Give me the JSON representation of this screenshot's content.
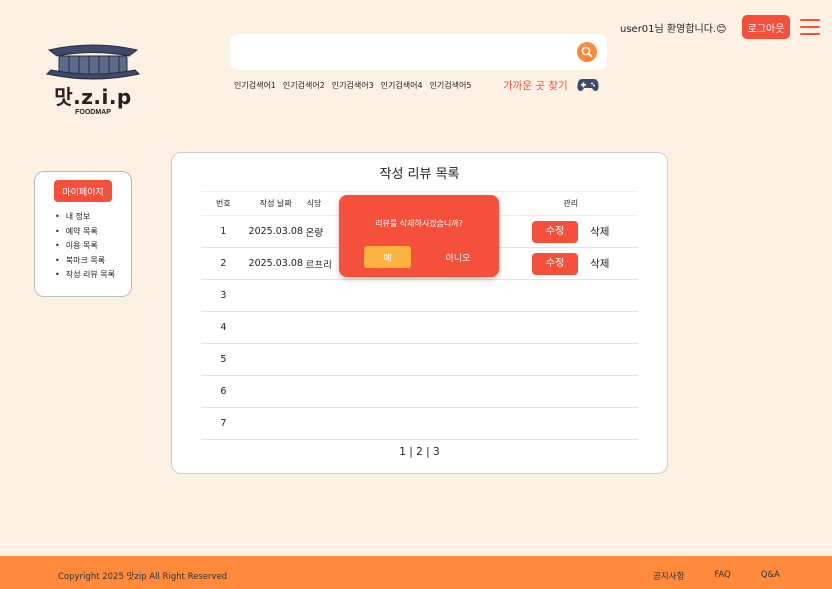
{
  "header": {
    "brand": "맛.z.i.p",
    "brand_sub": "FOODMAP",
    "search": {
      "placeholder": ""
    },
    "popular_searches": [
      "인기검색어1",
      "인기검색어2",
      "인기검색어3",
      "인기검색어4",
      "인기검색어5"
    ],
    "nearby_label": "가까운 곳 찾기",
    "welcome": "user01님 환영합니다.😊",
    "logout_label": "로그아웃",
    "icons": {
      "search": "search-icon",
      "game": "gamepad-icon",
      "menu": "hamburger-menu-icon",
      "logo": "hanok-roof-icon"
    }
  },
  "sidebar": {
    "title": "마이페이지",
    "items": [
      "내 정보",
      "예약 목록",
      "이용 목록",
      "북마크 목록",
      "작성 리뷰 목록"
    ]
  },
  "main": {
    "title": "작성 리뷰 목록",
    "columns": [
      "번호",
      "작성 날짜",
      "식당",
      "",
      "관리"
    ],
    "rows": [
      {
        "num": "1",
        "date": "2025.03.08",
        "restaurant": "온량",
        "edit": "수정",
        "delete": "삭제"
      },
      {
        "num": "2",
        "date": "2025.03.08",
        "restaurant": "르프리",
        "edit": "수정",
        "delete": "삭제"
      },
      {
        "num": "3",
        "date": "",
        "restaurant": "",
        "edit": "",
        "delete": ""
      },
      {
        "num": "4",
        "date": "",
        "restaurant": "",
        "edit": "",
        "delete": ""
      },
      {
        "num": "5",
        "date": "",
        "restaurant": "",
        "edit": "",
        "delete": ""
      },
      {
        "num": "6",
        "date": "",
        "restaurant": "",
        "edit": "",
        "delete": ""
      },
      {
        "num": "7",
        "date": "",
        "restaurant": "",
        "edit": "",
        "delete": ""
      }
    ],
    "pagination": "1 | 2 | 3"
  },
  "modal": {
    "message": "리뷰를 삭제하시겠습니까?",
    "yes_label": "예",
    "no_label": "아니오"
  },
  "footer": {
    "copyright": "Copyright 2025 맛zip All Right Reserved",
    "links": [
      "공지사항",
      "FAQ",
      "Q&A"
    ]
  },
  "colors": {
    "background": "#fdf1e4",
    "accent": "#f4503c",
    "orange": "#ff8a3c",
    "yes_button": "#ffb23e"
  }
}
